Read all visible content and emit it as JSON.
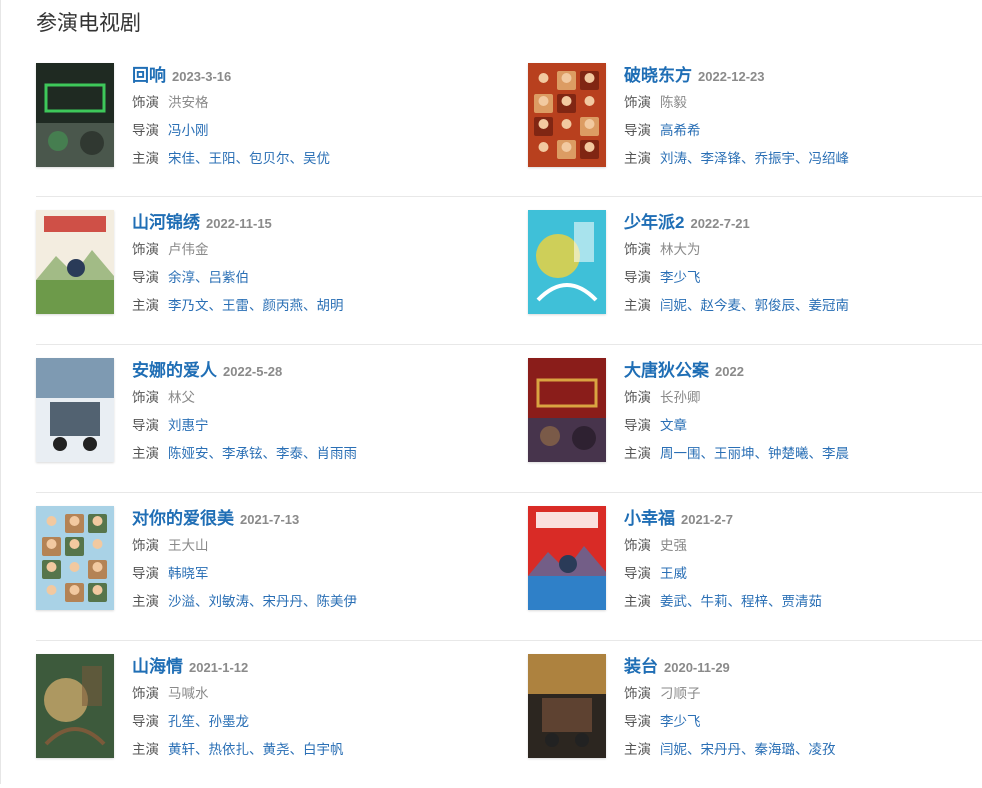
{
  "section_title": "参演电视剧",
  "labels": {
    "role": "饰演",
    "director": "导演",
    "starring": "主演"
  },
  "dramas": [
    {
      "title": "回响",
      "date": "2023-3-16",
      "role": "洪安格",
      "directors": [
        "冯小刚"
      ],
      "stars": [
        "宋佳",
        "王阳",
        "包贝尔",
        "吴优"
      ],
      "poster_palette": [
        "#1f2a22",
        "#3ec85a",
        "#5c6b5e"
      ]
    },
    {
      "title": "破晓东方",
      "date": "2022-12-23",
      "role": "陈毅",
      "directors": [
        "高希希"
      ],
      "stars": [
        "刘涛",
        "李泽锋",
        "乔振宇",
        "冯绍峰"
      ],
      "poster_palette": [
        "#b8401e",
        "#e0a66a",
        "#7a2412"
      ]
    },
    {
      "title": "山河锦绣",
      "date": "2022-11-15",
      "role": "卢伟金",
      "directors": [
        "余淳",
        "吕紫伯"
      ],
      "stars": [
        "李乃文",
        "王雷",
        "颜丙燕",
        "胡明"
      ],
      "poster_palette": [
        "#f3ede0",
        "#c8342b",
        "#6d9a4a"
      ]
    },
    {
      "title": "少年派2",
      "date": "2022-7-21",
      "role": "林大为",
      "directors": [
        "李少飞"
      ],
      "stars": [
        "闫妮",
        "赵今麦",
        "郭俊辰",
        "姜冠南"
      ],
      "poster_palette": [
        "#3fc0d8",
        "#f2d23a",
        "#ffffff"
      ]
    },
    {
      "title": "安娜的爱人",
      "date": "2022-5-28",
      "role": "林父",
      "directors": [
        "刘惠宁"
      ],
      "stars": [
        "陈娅安",
        "李承铉",
        "李泰",
        "肖雨雨"
      ],
      "poster_palette": [
        "#e9eef3",
        "#5a7e9c",
        "#2c3e50"
      ]
    },
    {
      "title": "大唐狄公案",
      "date": "2022",
      "role": "长孙卿",
      "directors": [
        "文章"
      ],
      "stars": [
        "周一围",
        "王丽坤",
        "钟楚曦",
        "李晨"
      ],
      "poster_palette": [
        "#8a1d1a",
        "#d9a441",
        "#2b3e63"
      ]
    },
    {
      "title": "对你的爱很美",
      "date": "2021-7-13",
      "role": "王大山",
      "directors": [
        "韩晓军"
      ],
      "stars": [
        "沙溢",
        "刘敏涛",
        "宋丹丹",
        "陈美伊"
      ],
      "poster_palette": [
        "#a9d2e6",
        "#b57a45",
        "#4d6a3a"
      ]
    },
    {
      "title": "小幸福",
      "date": "2021-2-7",
      "role": "史强",
      "directors": [
        "王威"
      ],
      "stars": [
        "姜武",
        "牛莉",
        "程梓",
        "贾清茹"
      ],
      "poster_palette": [
        "#d92b26",
        "#ffffff",
        "#2f80c8"
      ]
    },
    {
      "title": "山海情",
      "date": "2021-1-12",
      "role": "马喊水",
      "directors": [
        "孔笙",
        "孙墨龙"
      ],
      "stars": [
        "黄轩",
        "热依扎",
        "黄尧",
        "白宇帆"
      ],
      "poster_palette": [
        "#3d5a3c",
        "#c9a86a",
        "#7a5a3a"
      ]
    },
    {
      "title": "装台",
      "date": "2020-11-29",
      "role": "刁顺子",
      "directors": [
        "李少飞"
      ],
      "stars": [
        "闫妮",
        "宋丹丹",
        "秦海璐",
        "凌孜"
      ],
      "poster_palette": [
        "#2c2620",
        "#d8a24a",
        "#6b4a36"
      ]
    }
  ]
}
